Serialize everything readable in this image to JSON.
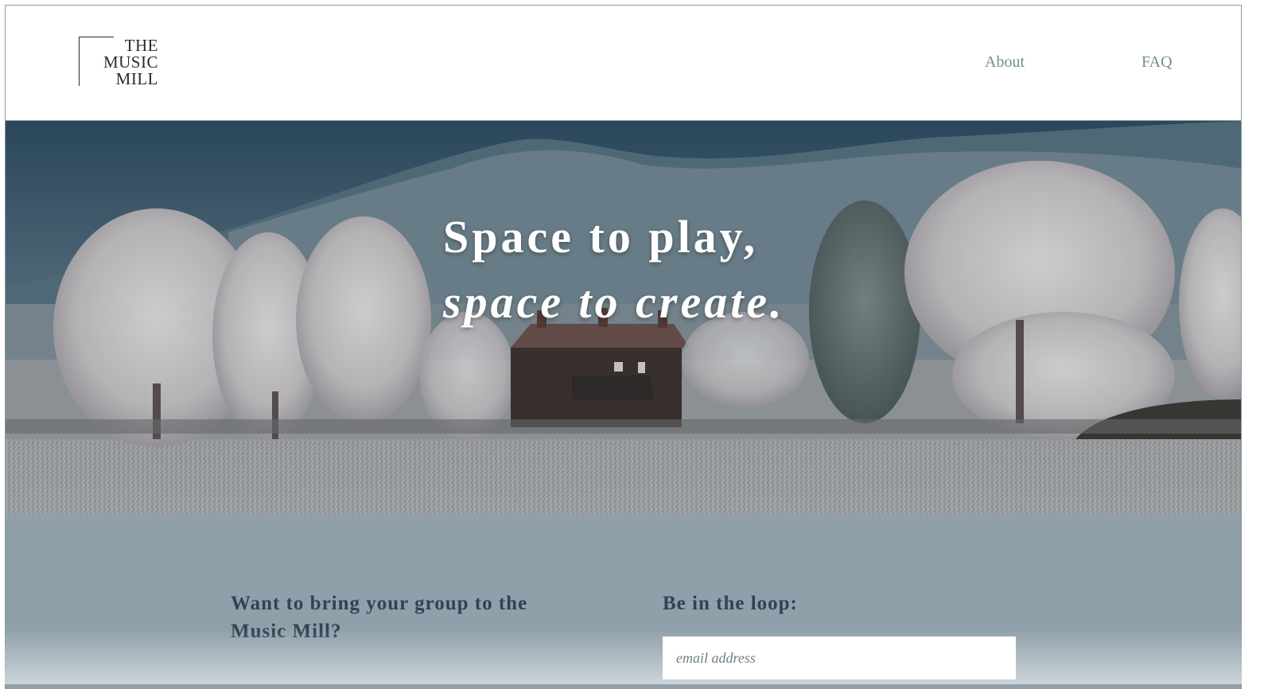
{
  "header": {
    "logo": {
      "line1": "THE",
      "line2": "MUSIC",
      "line3": "MILL"
    },
    "nav": {
      "about": "About",
      "faq": "FAQ"
    }
  },
  "hero": {
    "line1": "Space to play,",
    "line2": "space to create."
  },
  "lower": {
    "cta_heading": "Want to bring your group to the Music Mill?",
    "loop_heading": "Be in the loop:",
    "email_placeholder": "email address"
  },
  "colors": {
    "nav_link": "#6f8f8c",
    "lower_bg": "#8fa0aa",
    "heading": "#2f4452"
  }
}
